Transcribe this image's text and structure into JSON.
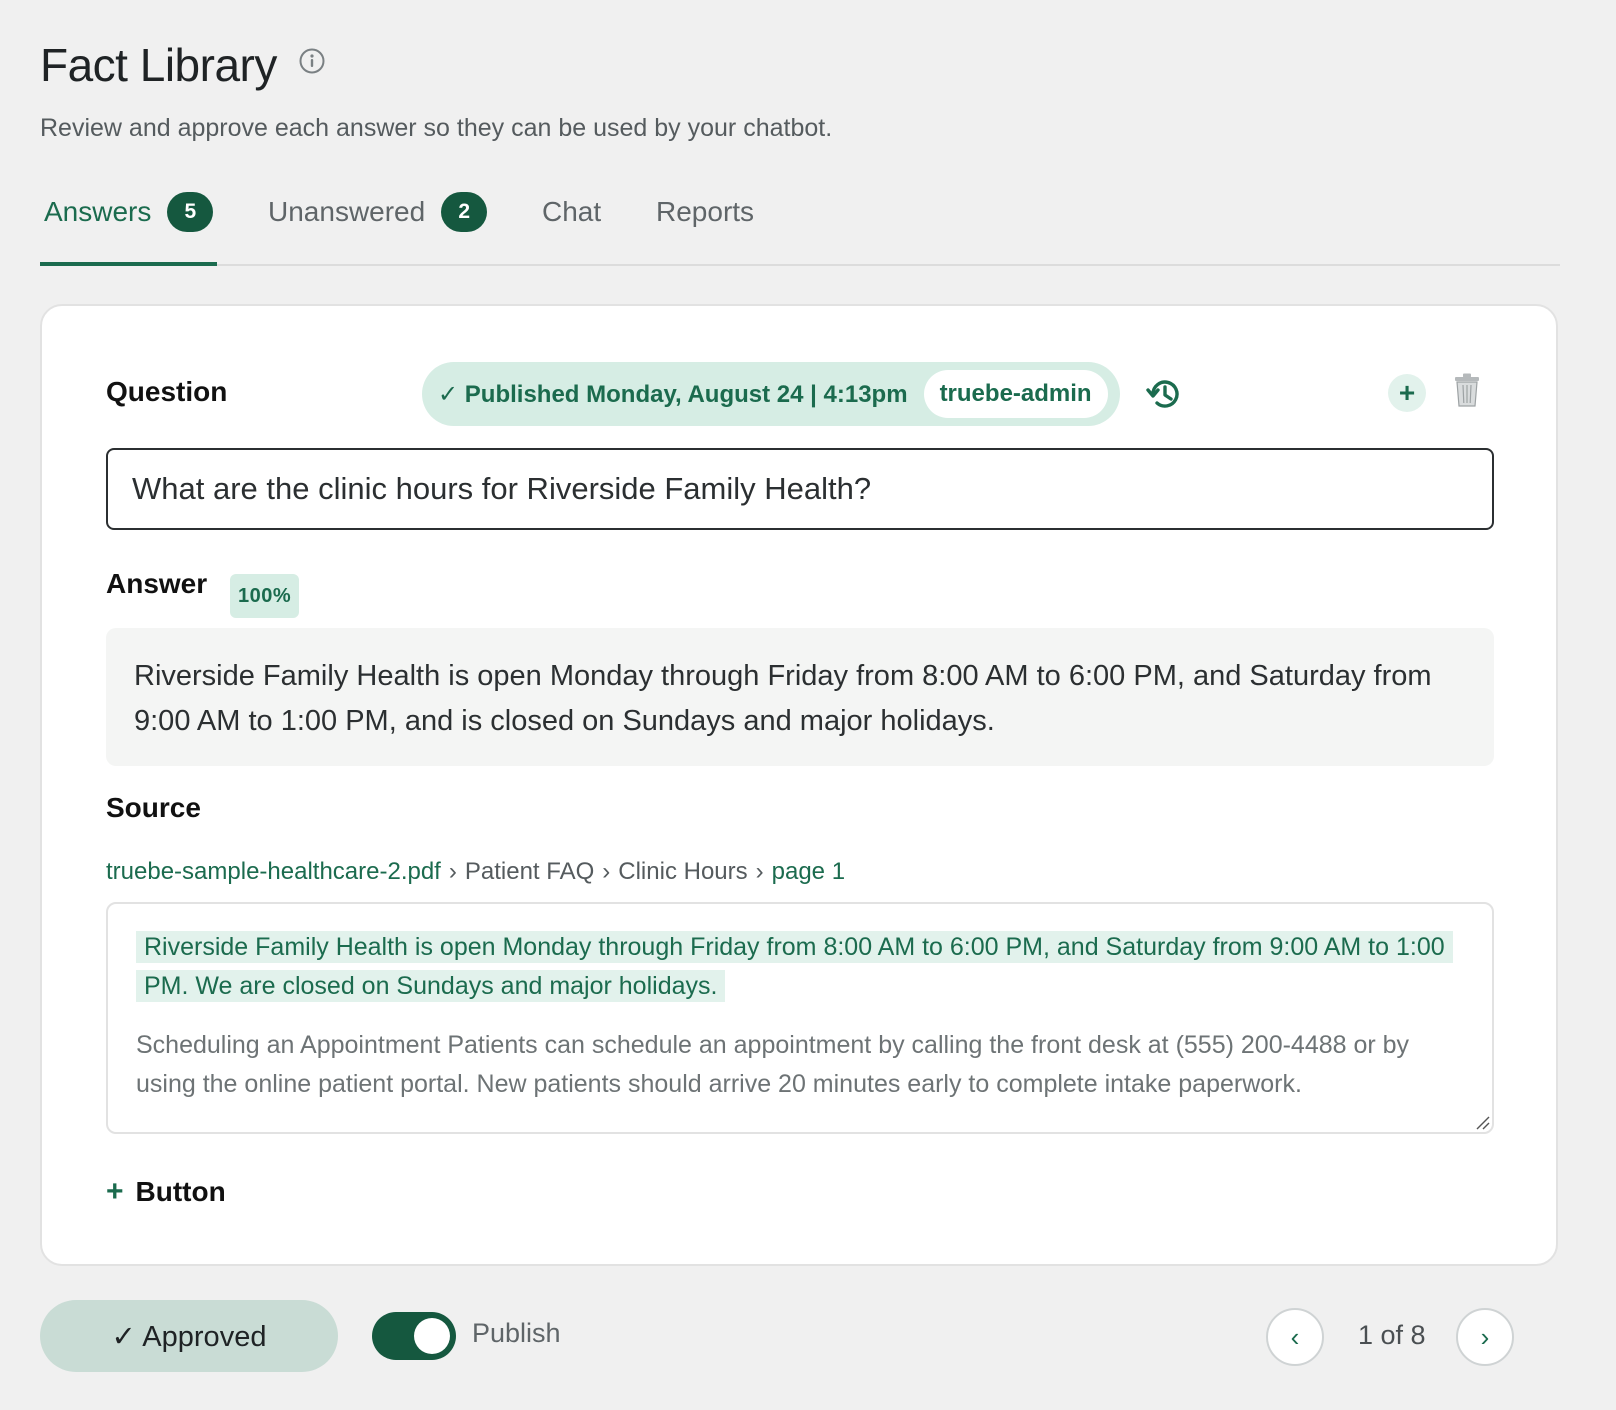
{
  "header": {
    "title": "Fact Library",
    "subtitle": "Review and approve each answer so they can be used by your chatbot."
  },
  "tabs": [
    {
      "label": "Answers",
      "badge": "5",
      "active": true
    },
    {
      "label": "Unanswered",
      "badge": "2",
      "active": false
    },
    {
      "label": "Chat",
      "badge": null,
      "active": false
    },
    {
      "label": "Reports",
      "badge": null,
      "active": false
    }
  ],
  "card": {
    "question_label": "Question",
    "published_status": "✓ Published Monday, August 24 | 4:13pm",
    "published_by": "truebe-admin",
    "add_symbol": "+",
    "question_value": "What are the clinic hours for Riverside Family Health?",
    "answer_label": "Answer",
    "confidence": "100%",
    "answer_text": "Riverside Family Health is open Monday through Friday from 8:00 AM to 6:00 PM, and Saturday from 9:00 AM to 1:00 PM, and is closed on Sundays and major holidays.",
    "source_label": "Source",
    "breadcrumb": {
      "file": "truebe-sample-healthcare-2.pdf",
      "section": "Patient FAQ",
      "subsection": "Clinic Hours",
      "page": "page 1",
      "separator": "›"
    },
    "source_highlight": "Riverside Family Health is open Monday through Friday from 8:00 AM to 6:00 PM, and Saturday from 9:00 AM to 1:00 PM. We are closed on Sundays and major holidays.",
    "source_rest": "Scheduling an Appointment Patients can schedule an appointment by calling the front desk at (555) 200-4488 or by using the online patient portal. New patients should arrive 20 minutes early to complete intake paperwork.",
    "add_button_symbol": "+",
    "add_button_label": "Button"
  },
  "footer": {
    "approved_label": "✓ Approved",
    "publish_label": "Publish",
    "publish_on": true,
    "prev_symbol": "‹",
    "next_symbol": "›",
    "pager_text": "1 of 8"
  },
  "colors": {
    "accent": "#1b6b4e",
    "accent_dark": "#15583f",
    "accent_light": "#d6ede4",
    "background": "#f0f0f0"
  },
  "icons": {
    "info": "info-circle-icon",
    "history": "history-icon",
    "add": "plus-icon",
    "delete": "trash-icon",
    "check": "check-icon"
  }
}
